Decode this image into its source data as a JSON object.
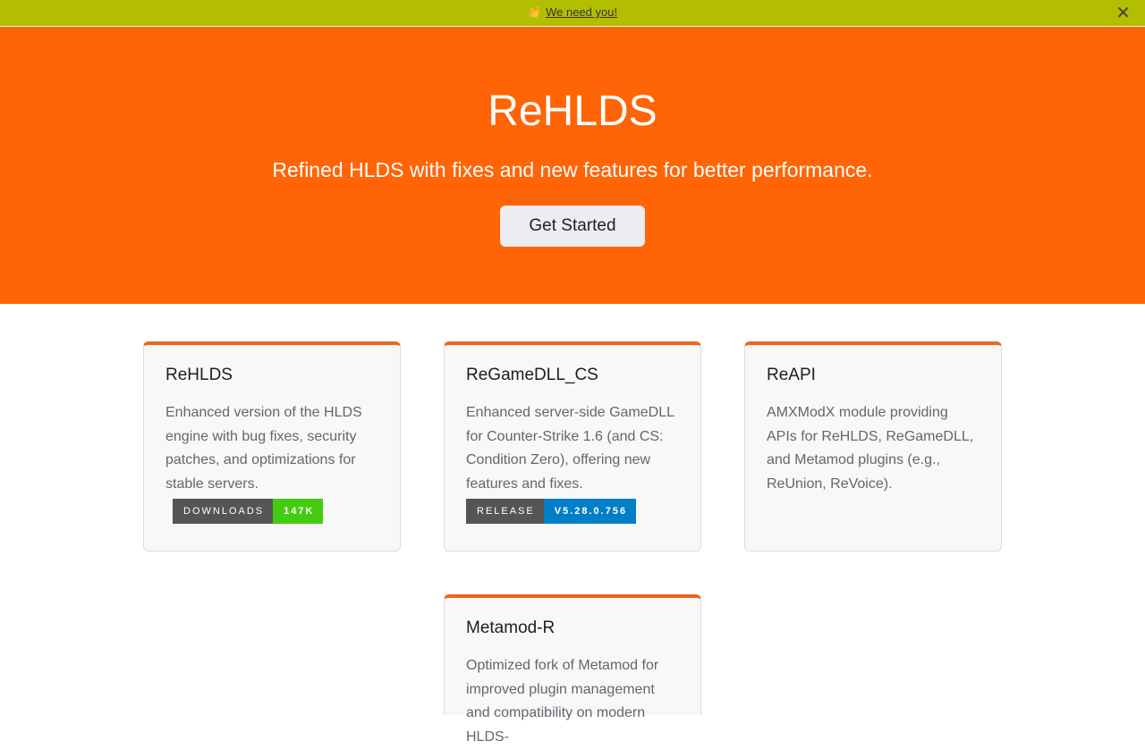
{
  "announcement": {
    "emoji": "👏",
    "text": "We need you!",
    "close": "✕"
  },
  "hero": {
    "title": "ReHLDS",
    "tagline": "Refined HLDS with fixes and new features for better performance.",
    "cta": "Get Started"
  },
  "cards": [
    {
      "title": "ReHLDS",
      "description": "Enhanced version of the HLDS engine with bug fixes, security patches, and optimizations for stable servers.",
      "badge": {
        "label": "DOWNLOADS",
        "value": "147K",
        "color": "#44cc11"
      }
    },
    {
      "title": "ReGameDLL_CS",
      "description": "Enhanced server-side GameDLL for Counter-Strike 1.6 (and CS: Condition Zero), offering new features and fixes.",
      "badge": {
        "label": "RELEASE",
        "value": "V5.28.0.756",
        "color": "#007ec6"
      }
    },
    {
      "title": "ReAPI",
      "description": "AMXModX module providing APIs for ReHLDS, ReGameDLL, and Metamod plugins (e.g., ReUnion, ReVoice)."
    },
    {
      "title": "Metamod-R",
      "description": "Optimized fork of Metamod for improved plugin management and compatibility on modern HLDS-"
    }
  ],
  "colors": {
    "announcement_bg": "#b4be00",
    "hero_bg": "#ff6406",
    "card_accent": "#f0651b"
  }
}
